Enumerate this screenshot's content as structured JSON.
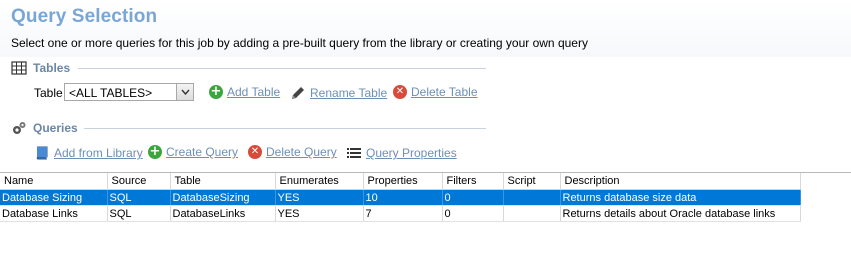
{
  "header": {
    "title": "Query Selection",
    "subtitle": "Select one or more queries for this job by adding a pre-built query from the library or creating your own query"
  },
  "tables_section": {
    "heading": "Tables",
    "field_label": "Table",
    "selected_value": "<ALL TABLES>",
    "actions": {
      "add": "Add Table",
      "rename": "Rename Table",
      "delete": "Delete Table"
    }
  },
  "queries_section": {
    "heading": "Queries",
    "actions": {
      "add_from_library": "Add from Library",
      "create": "Create Query",
      "delete": "Delete Query",
      "properties": "Query Properties"
    }
  },
  "grid": {
    "columns": [
      "Name",
      "Source",
      "Table",
      "Enumerates",
      "Properties",
      "Filters",
      "Script",
      "Description"
    ],
    "rows": [
      {
        "name": "Database Sizing",
        "source": "SQL",
        "table": "DatabaseSizing",
        "enumerates": "YES",
        "properties": "10",
        "filters": "0",
        "script": "",
        "description": "Returns database size data",
        "selected": true
      },
      {
        "name": "Database Links",
        "source": "SQL",
        "table": "DatabaseLinks",
        "enumerates": "YES",
        "properties": "7",
        "filters": "0",
        "script": "",
        "description": "Returns details about Oracle database links",
        "selected": false
      }
    ]
  },
  "colors": {
    "title": "#7aa6d6",
    "link": "#6d8fb5",
    "selection": "#0078d7",
    "add": "#3da53d",
    "delete": "#d94a3a"
  }
}
